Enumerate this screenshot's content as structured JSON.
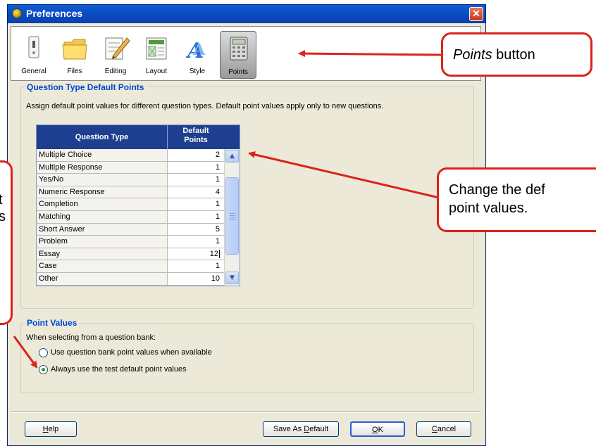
{
  "window": {
    "title": "Preferences",
    "close_glyph": "✕"
  },
  "toolbar": {
    "items": [
      {
        "label": "General",
        "icon": "switch-icon",
        "selected": false
      },
      {
        "label": "Files",
        "icon": "folder-icon",
        "selected": false
      },
      {
        "label": "Editing",
        "icon": "notepad-pencil-icon",
        "selected": false
      },
      {
        "label": "Layout",
        "icon": "layout-icon",
        "selected": false
      },
      {
        "label": "Style",
        "icon": "font-style-icon",
        "selected": false
      },
      {
        "label": "Points",
        "icon": "calculator-icon",
        "selected": true
      }
    ]
  },
  "qt_group": {
    "title": "Question Type Default Points",
    "description": "Assign default point values for different question types.  Default point values apply only to new questions."
  },
  "table": {
    "headers": {
      "type": "Question Type",
      "points_line1": "Default",
      "points_line2": "Points"
    },
    "rows": [
      {
        "type": "Multiple Choice",
        "points": "2"
      },
      {
        "type": "Multiple Response",
        "points": "1"
      },
      {
        "type": "Yes/No",
        "points": "1"
      },
      {
        "type": "Numeric Response",
        "points": "4"
      },
      {
        "type": "Completion",
        "points": "1"
      },
      {
        "type": "Matching",
        "points": "1"
      },
      {
        "type": "Short Answer",
        "points": "5"
      },
      {
        "type": "Problem",
        "points": "1"
      },
      {
        "type": "Essay",
        "points": "12"
      },
      {
        "type": "Case",
        "points": "1"
      },
      {
        "type": "Other",
        "points": "10"
      }
    ],
    "editing_row_index": 8
  },
  "pv_group": {
    "title": "Point Values",
    "prompt": "When selecting from a question bank:",
    "options": [
      {
        "label": "Use question bank point values when available",
        "checked": false
      },
      {
        "label": "Always use the test default point values",
        "checked": true
      }
    ]
  },
  "buttons": {
    "help": "Help",
    "help_key": "H",
    "help_rest": "elp",
    "save_default_pre": "Save As ",
    "save_default_key": "D",
    "save_default_post": "efault",
    "ok_key": "O",
    "ok_rest": "K",
    "cancel_key": "C",
    "cancel_rest": "ancel"
  },
  "callouts": {
    "points_em": "Points",
    "points_rest": " button",
    "change_line1": "Change the def",
    "change_line2": "point values.",
    "left_line1": "t",
    "left_line2": "s"
  },
  "colors": {
    "accent_red": "#d9241b",
    "table_header": "#1e3f8f",
    "group_title": "#0046d5"
  }
}
